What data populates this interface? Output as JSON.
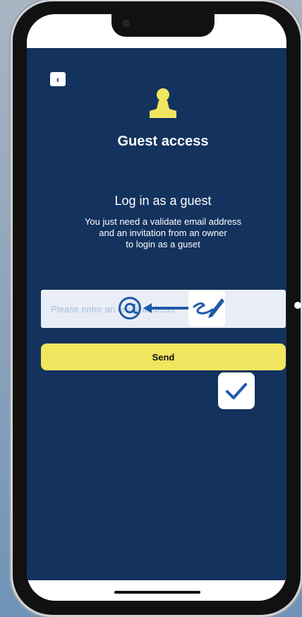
{
  "colors": {
    "app_background": "#13325e",
    "accent_yellow": "#f2e660",
    "input_background": "#e9eef6",
    "icon_blue": "#1f5aa8"
  },
  "header": {
    "back_icon": "chevron-left-icon",
    "back_glyph": "‹",
    "title": "Guest access"
  },
  "main": {
    "subtitle": "Log in as a guest",
    "description_lines": [
      "You just need a validate email address",
      "and an invitation from an owner",
      "to login as a guset"
    ]
  },
  "form": {
    "email_placeholder": "Please enter an email address",
    "send_label": "Send"
  },
  "overlays": {
    "at_icon": "at-sign-icon",
    "arrow_icon": "arrow-left-icon",
    "pen_icon": "pen-signature-icon",
    "check_icon": "checkmark-icon"
  }
}
